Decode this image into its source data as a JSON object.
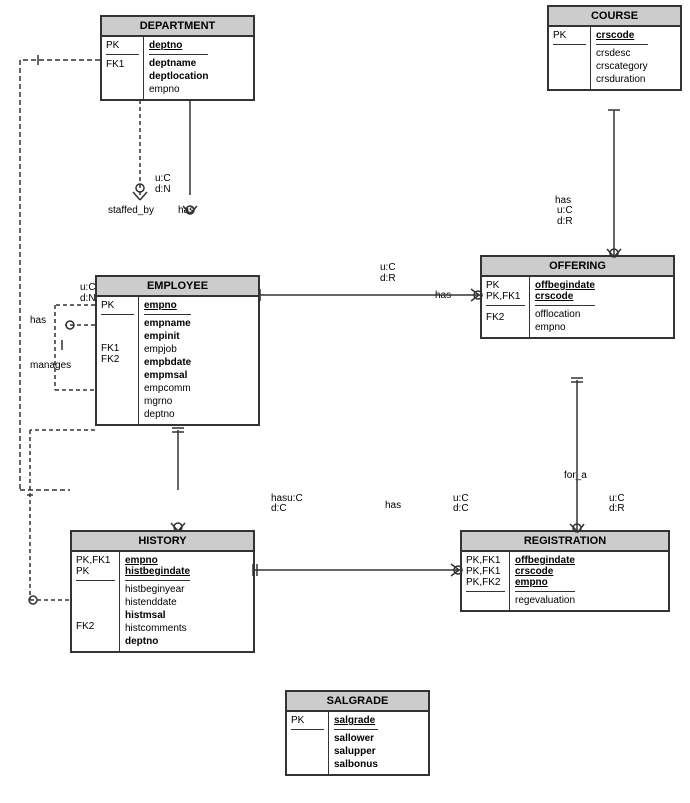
{
  "entities": {
    "department": {
      "title": "DEPARTMENT",
      "pk_label": "PK",
      "pk_attr": "deptno",
      "fk_labels": [
        "FK1"
      ],
      "attrs_top": [],
      "attrs_body": [
        "deptname",
        "deptlocation",
        "empno"
      ],
      "fk_body": [
        "FK1",
        "",
        ""
      ]
    },
    "employee": {
      "title": "EMPLOYEE",
      "pk_label": "PK",
      "pk_attr": "empno",
      "attrs_body": [
        "empname",
        "empinit",
        "empjob",
        "empbdate",
        "empmsal",
        "empcomm",
        "mgrno",
        "deptno"
      ],
      "fk_labels": [
        "FK1",
        "FK2"
      ]
    },
    "course": {
      "title": "COURSE",
      "pk_label": "PK",
      "pk_attr": "crscode",
      "attrs_body": [
        "crsdesc",
        "crscategory",
        "crsduration"
      ]
    },
    "offering": {
      "title": "OFFERING",
      "pk_label": "PK",
      "pk_fk_label": "PK,FK1",
      "pk_attrs": [
        "offbegindate",
        "crscode"
      ],
      "fk2_label": "FK2",
      "attrs_body": [
        "offlocation",
        "empno"
      ]
    },
    "history": {
      "title": "HISTORY",
      "pk1_label": "PK,FK1",
      "pk2_label": "PK",
      "pk1_attr": "empno",
      "pk2_attr": "histbegindate",
      "attrs_body": [
        "histbeginyear",
        "histenddate",
        "histmsal",
        "histcomments",
        "deptno"
      ],
      "fk2_label": "FK2"
    },
    "registration": {
      "title": "REGISTRATION",
      "pk_fk1_label": "PK,FK1",
      "pk_fk1b_label": "PK,FK1",
      "pk_fk2_label": "PK,FK2",
      "pk_attrs": [
        "offbegindate",
        "crscode",
        "empno"
      ],
      "attrs_body": [
        "regevaluation"
      ]
    },
    "salgrade": {
      "title": "SALGRADE",
      "pk_label": "PK",
      "pk_attr": "salgrade",
      "attrs_body": [
        "sallower",
        "salupper",
        "salbonus"
      ]
    }
  },
  "labels": {
    "has": "has",
    "staffed_by": "staffed_by",
    "manages": "manages",
    "for_a": "for_a",
    "hasu_c": "hasu:C",
    "hasd_c": "d:C",
    "uc": "u:C",
    "dr": "d:R",
    "dn": "d:N",
    "dc": "d:C"
  }
}
